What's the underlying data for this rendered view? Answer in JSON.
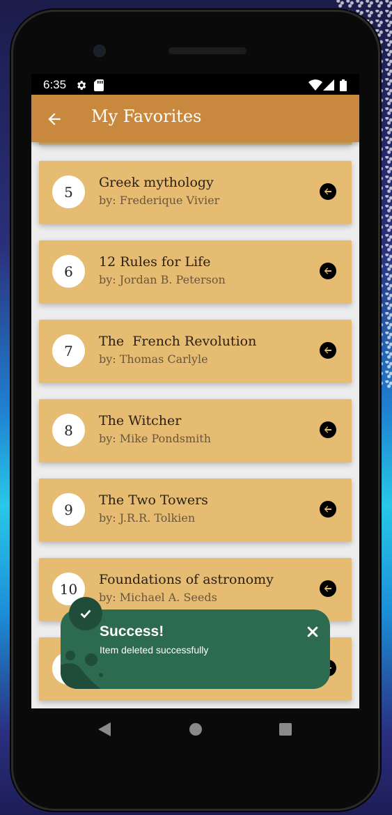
{
  "status_bar": {
    "time": "6:35",
    "icons": [
      "gear-icon",
      "sd-card-icon",
      "wifi-icon",
      "signal-icon",
      "battery-icon"
    ]
  },
  "app_bar": {
    "title": "My Favorites",
    "back_icon": "arrow-left-icon"
  },
  "favorites": [
    {
      "number": "5",
      "title": "Greek mythology",
      "author": "by: Frederique Vivier"
    },
    {
      "number": "6",
      "title": "12 Rules for Life",
      "author": "by: Jordan B. Peterson"
    },
    {
      "number": "7",
      "title": "The  French Revolution",
      "author": "by: Thomas Carlyle"
    },
    {
      "number": "8",
      "title": "The Witcher",
      "author": "by: Mike Pondsmith"
    },
    {
      "number": "9",
      "title": "The Two Towers",
      "author": "by: J.R.R. Tolkien"
    },
    {
      "number": "10",
      "title": "Foundations of astronomy",
      "author": "by: Michael A. Seeds"
    }
  ],
  "toast": {
    "title": "Success!",
    "message": "Item deleted successfully",
    "icon": "check-icon",
    "close_icon": "close-icon"
  },
  "nav": {
    "back": "back-triangle-icon",
    "home": "home-circle-icon",
    "recents": "recents-square-icon"
  },
  "colors": {
    "app_bar": "#c8893f",
    "card": "#e6bb72",
    "toast": "#2c6b4f",
    "content_bg": "#ededed"
  }
}
